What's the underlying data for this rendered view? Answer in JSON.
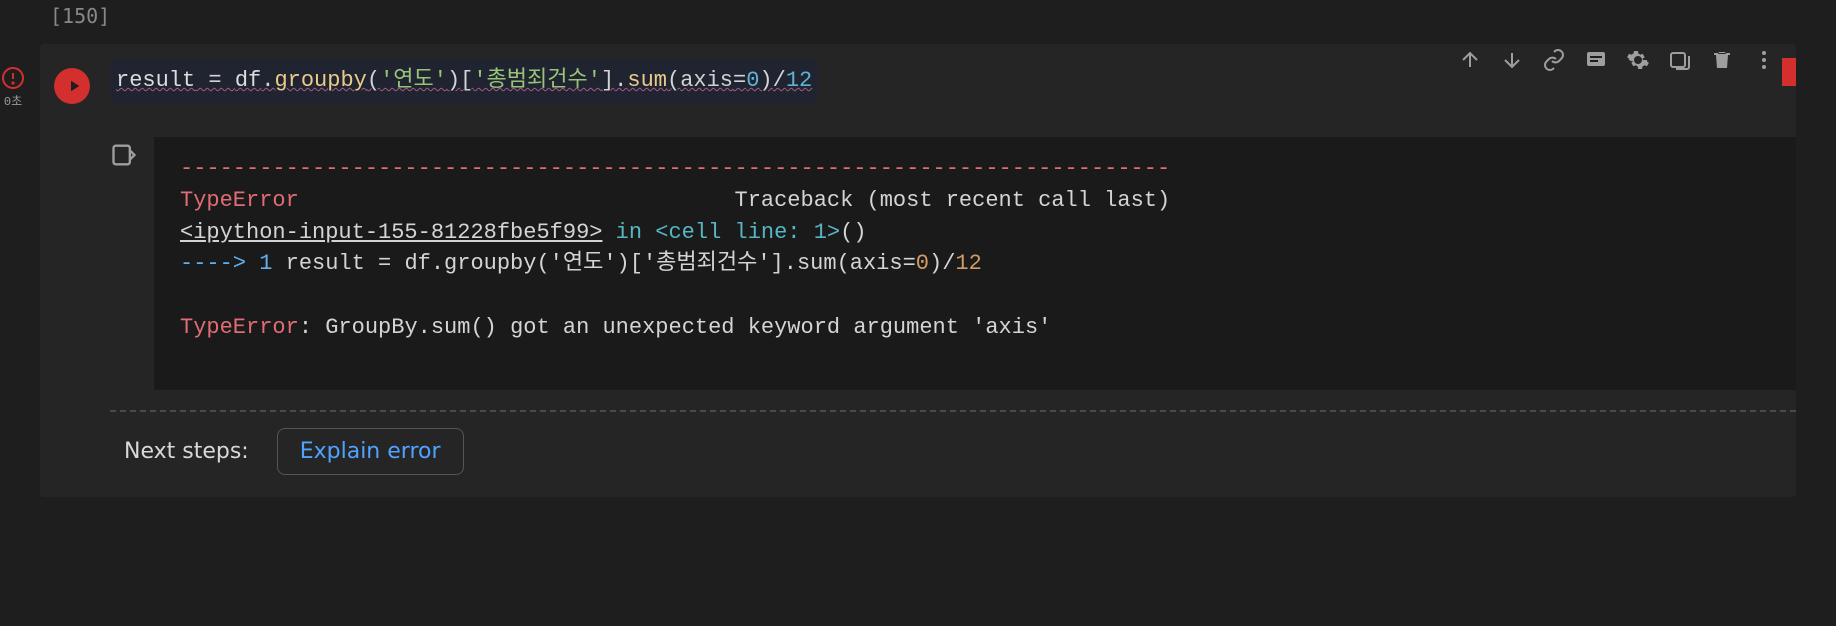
{
  "prev_cell_exec_count": "[150]",
  "exec_timing": "0초",
  "code": {
    "var": "result",
    "assign": " = ",
    "obj": "df",
    "dot1": ".",
    "groupby": "groupby",
    "lp1": "(",
    "str1": "'연도'",
    "rp1": ")",
    "lb1": "[",
    "str2": "'총범죄건수'",
    "rb1": "]",
    "dot2": ".",
    "sum": "sum",
    "lp2": "(",
    "kw_axis": "axis",
    "eq": "=",
    "num0": "0",
    "rp2": ")",
    "slash": "/",
    "num12": "12"
  },
  "traceback": {
    "sep": "---------------------------------------------------------------------------",
    "err_type_header": "TypeError",
    "header_right": "                                 Traceback (most recent call last)",
    "link": "<ipython-input-155-81228fbe5f99>",
    "in_word": " in ",
    "cell_line": "<cell line: 1>",
    "paren": "()",
    "arrow": "----> ",
    "line_no": "1",
    "code_echo": " result = df.groupby('연도')['총범죄건수'].sum(axis=",
    "axis_val": "0",
    "code_echo_tail": ")/",
    "tail_num": "12",
    "err_type_final": "TypeError",
    "err_msg": ": GroupBy.sum() got an unexpected keyword argument 'axis'"
  },
  "next_steps": {
    "label": "Next steps:",
    "explain_button": "Explain error"
  },
  "toolbar_icons": [
    "move-up",
    "move-down",
    "link",
    "comment",
    "settings",
    "mirror",
    "delete",
    "more"
  ]
}
